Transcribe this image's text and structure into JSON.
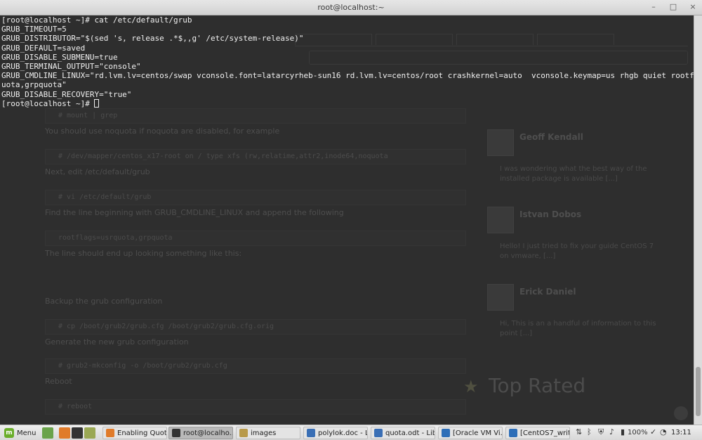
{
  "window": {
    "title": "root@localhost:~",
    "controls": [
      "–",
      "□",
      "×"
    ]
  },
  "terminal": {
    "lines": [
      "[root@localhost ~]# cat /etc/default/grub",
      "GRUB_TIMEOUT=5",
      "GRUB_DISTRIBUTOR=\"$(sed 's, release .*$,,g' /etc/system-release)\"",
      "GRUB_DEFAULT=saved",
      "GRUB_DISABLE_SUBMENU=true",
      "GRUB_TERMINAL_OUTPUT=\"console\"",
      "GRUB_CMDLINE_LINUX=\"rd.lvm.lv=centos/swap vconsole.font=latarcyrheb-sun16 rd.lvm.lv=centos/root crashkernel=auto  vconsole.keymap=us rhgb quiet rootflags=usrq",
      "uota,grpquota\"",
      "GRUB_DISABLE_RECOVERY=\"true\"",
      "[root@localhost ~]# "
    ]
  },
  "background_page": {
    "paragraphs": [
      "You should use noquota if noquota are disabled, for example",
      "Next, edit /etc/default/grub",
      "Find the line beginning with GRUB_CMDLINE_LINUX and append the following",
      "The line should end up looking something like this:",
      "Backup the grub configuration",
      "Generate the new grub configuration",
      "Reboot"
    ],
    "code_lines": [
      "# mount | grep",
      "# /dev/mapper/centos_x17-root on / type xfs (rw,relatime,attr2,inode64,noquota",
      "# vi /etc/default/grub",
      "rootflags=usrquota,grpquota",
      "# cp /boot/grub2/grub.cfg /boot/grub2/grub.cfg.orig",
      "# grub2-mkconfig -o /boot/grub2/grub.cfg",
      "# reboot"
    ],
    "comments": [
      {
        "name": "Geoff Kendall",
        "text": "I was wondering what the best way of the installed package is available [...]"
      },
      {
        "name": "Istvan Dobos",
        "text": "Hello! I just tried to fix your guide CentOS 7 on vmware, [...]"
      },
      {
        "name": "Erick Daniel",
        "text": "Hi, This is an a handful of information to this point [...]"
      }
    ],
    "sidebar_heading": "Top Rated"
  },
  "taskbar": {
    "menu_label": "Menu",
    "tasks": [
      {
        "label": "Enabling Quot...",
        "color": "#e07b2a"
      },
      {
        "label": "root@localho...",
        "color": "#333333",
        "active": true
      },
      {
        "label": "images",
        "color": "#b89a4a"
      },
      {
        "label": "polylok.doc - L...",
        "color": "#3a6fb5"
      },
      {
        "label": "quota.odt - Lib...",
        "color": "#3a6fb5"
      },
      {
        "label": "[Oracle VM Vi...",
        "color": "#2d6eb8"
      },
      {
        "label": "[CentOS7_writ...",
        "color": "#2d6eb8"
      }
    ],
    "battery": "100%",
    "time": "13:11"
  }
}
